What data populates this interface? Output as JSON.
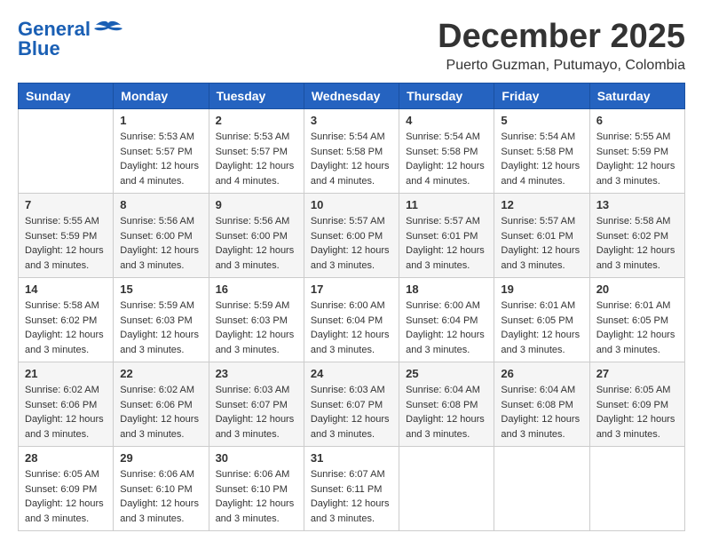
{
  "logo": {
    "line1": "General",
    "line2": "Blue"
  },
  "title": "December 2025",
  "location": "Puerto Guzman, Putumayo, Colombia",
  "days_of_week": [
    "Sunday",
    "Monday",
    "Tuesday",
    "Wednesday",
    "Thursday",
    "Friday",
    "Saturday"
  ],
  "weeks": [
    [
      {
        "day": "",
        "info": ""
      },
      {
        "day": "1",
        "info": "Sunrise: 5:53 AM\nSunset: 5:57 PM\nDaylight: 12 hours\nand 4 minutes."
      },
      {
        "day": "2",
        "info": "Sunrise: 5:53 AM\nSunset: 5:57 PM\nDaylight: 12 hours\nand 4 minutes."
      },
      {
        "day": "3",
        "info": "Sunrise: 5:54 AM\nSunset: 5:58 PM\nDaylight: 12 hours\nand 4 minutes."
      },
      {
        "day": "4",
        "info": "Sunrise: 5:54 AM\nSunset: 5:58 PM\nDaylight: 12 hours\nand 4 minutes."
      },
      {
        "day": "5",
        "info": "Sunrise: 5:54 AM\nSunset: 5:58 PM\nDaylight: 12 hours\nand 4 minutes."
      },
      {
        "day": "6",
        "info": "Sunrise: 5:55 AM\nSunset: 5:59 PM\nDaylight: 12 hours\nand 3 minutes."
      }
    ],
    [
      {
        "day": "7",
        "info": "Sunrise: 5:55 AM\nSunset: 5:59 PM\nDaylight: 12 hours\nand 3 minutes."
      },
      {
        "day": "8",
        "info": "Sunrise: 5:56 AM\nSunset: 6:00 PM\nDaylight: 12 hours\nand 3 minutes."
      },
      {
        "day": "9",
        "info": "Sunrise: 5:56 AM\nSunset: 6:00 PM\nDaylight: 12 hours\nand 3 minutes."
      },
      {
        "day": "10",
        "info": "Sunrise: 5:57 AM\nSunset: 6:00 PM\nDaylight: 12 hours\nand 3 minutes."
      },
      {
        "day": "11",
        "info": "Sunrise: 5:57 AM\nSunset: 6:01 PM\nDaylight: 12 hours\nand 3 minutes."
      },
      {
        "day": "12",
        "info": "Sunrise: 5:57 AM\nSunset: 6:01 PM\nDaylight: 12 hours\nand 3 minutes."
      },
      {
        "day": "13",
        "info": "Sunrise: 5:58 AM\nSunset: 6:02 PM\nDaylight: 12 hours\nand 3 minutes."
      }
    ],
    [
      {
        "day": "14",
        "info": "Sunrise: 5:58 AM\nSunset: 6:02 PM\nDaylight: 12 hours\nand 3 minutes."
      },
      {
        "day": "15",
        "info": "Sunrise: 5:59 AM\nSunset: 6:03 PM\nDaylight: 12 hours\nand 3 minutes."
      },
      {
        "day": "16",
        "info": "Sunrise: 5:59 AM\nSunset: 6:03 PM\nDaylight: 12 hours\nand 3 minutes."
      },
      {
        "day": "17",
        "info": "Sunrise: 6:00 AM\nSunset: 6:04 PM\nDaylight: 12 hours\nand 3 minutes."
      },
      {
        "day": "18",
        "info": "Sunrise: 6:00 AM\nSunset: 6:04 PM\nDaylight: 12 hours\nand 3 minutes."
      },
      {
        "day": "19",
        "info": "Sunrise: 6:01 AM\nSunset: 6:05 PM\nDaylight: 12 hours\nand 3 minutes."
      },
      {
        "day": "20",
        "info": "Sunrise: 6:01 AM\nSunset: 6:05 PM\nDaylight: 12 hours\nand 3 minutes."
      }
    ],
    [
      {
        "day": "21",
        "info": "Sunrise: 6:02 AM\nSunset: 6:06 PM\nDaylight: 12 hours\nand 3 minutes."
      },
      {
        "day": "22",
        "info": "Sunrise: 6:02 AM\nSunset: 6:06 PM\nDaylight: 12 hours\nand 3 minutes."
      },
      {
        "day": "23",
        "info": "Sunrise: 6:03 AM\nSunset: 6:07 PM\nDaylight: 12 hours\nand 3 minutes."
      },
      {
        "day": "24",
        "info": "Sunrise: 6:03 AM\nSunset: 6:07 PM\nDaylight: 12 hours\nand 3 minutes."
      },
      {
        "day": "25",
        "info": "Sunrise: 6:04 AM\nSunset: 6:08 PM\nDaylight: 12 hours\nand 3 minutes."
      },
      {
        "day": "26",
        "info": "Sunrise: 6:04 AM\nSunset: 6:08 PM\nDaylight: 12 hours\nand 3 minutes."
      },
      {
        "day": "27",
        "info": "Sunrise: 6:05 AM\nSunset: 6:09 PM\nDaylight: 12 hours\nand 3 minutes."
      }
    ],
    [
      {
        "day": "28",
        "info": "Sunrise: 6:05 AM\nSunset: 6:09 PM\nDaylight: 12 hours\nand 3 minutes."
      },
      {
        "day": "29",
        "info": "Sunrise: 6:06 AM\nSunset: 6:10 PM\nDaylight: 12 hours\nand 3 minutes."
      },
      {
        "day": "30",
        "info": "Sunrise: 6:06 AM\nSunset: 6:10 PM\nDaylight: 12 hours\nand 3 minutes."
      },
      {
        "day": "31",
        "info": "Sunrise: 6:07 AM\nSunset: 6:11 PM\nDaylight: 12 hours\nand 3 minutes."
      },
      {
        "day": "",
        "info": ""
      },
      {
        "day": "",
        "info": ""
      },
      {
        "day": "",
        "info": ""
      }
    ]
  ]
}
